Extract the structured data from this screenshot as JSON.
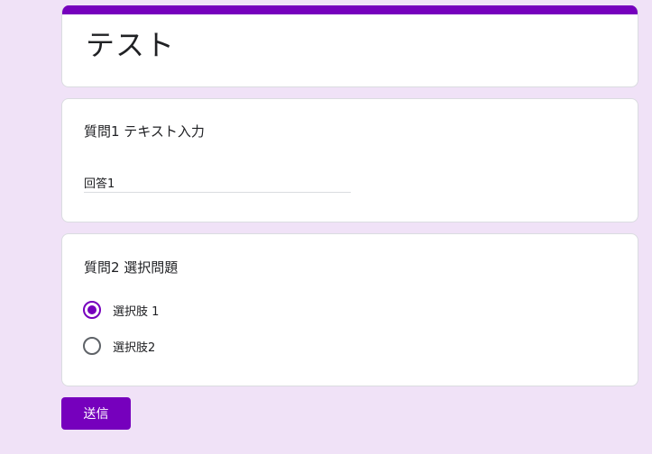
{
  "form": {
    "title": "テスト",
    "accent_color": "#7600bd",
    "background_color": "#f0e2f7"
  },
  "questions": [
    {
      "title": "質問1 テキスト入力",
      "type": "text",
      "value": "回答1"
    },
    {
      "title": "質問2 選択問題",
      "type": "radio",
      "options": [
        {
          "label": "選択肢 1",
          "selected": true
        },
        {
          "label": "選択肢2",
          "selected": false
        }
      ]
    }
  ],
  "submit_label": "送信"
}
